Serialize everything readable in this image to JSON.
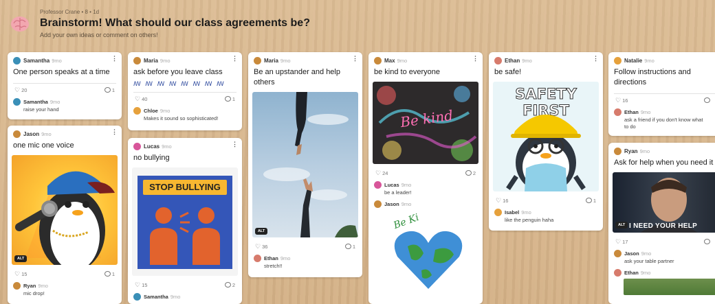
{
  "header": {
    "meta": "Professor Crane • 8 • 1d",
    "title": "Brainstorm! What should our class agreements be?",
    "subtitle": "Add your own ideas or comment on others!"
  },
  "colors": {
    "board_bg": "#d9b890",
    "card_bg": "#ffffff",
    "accent_heart": "#666666"
  },
  "cards": {
    "c1": {
      "author": "Samantha",
      "time": "9mo",
      "title": "One person speaks at a time",
      "likes": "20",
      "comments": "1",
      "comment1": {
        "author": "Samantha",
        "time": "9mo",
        "text": "raise your hand"
      }
    },
    "c2": {
      "author": "Jason",
      "time": "9mo",
      "title": "one mic one voice",
      "alt": "ALT",
      "likes": "15",
      "comments": "1",
      "comment1": {
        "author": "Ryan",
        "time": "9mo",
        "text": "mic drop!"
      }
    },
    "c3": {
      "author": "Maria",
      "time": "9mo",
      "title": "ask before you leave class",
      "squiggles": "ꟿ ꟿ ꟿ ꟿ ꟿ ꟿ ꟿ ꟿ",
      "likes": "40",
      "comments": "1",
      "comment1": {
        "author": "Chloe",
        "time": "9mo",
        "text": "Makes it sound so sophisticated!"
      }
    },
    "c4": {
      "author": "Lucas",
      "time": "9mo",
      "title": "no bullying",
      "image_text": "STOP BULLYING",
      "likes": "15",
      "comments": "2",
      "comment1": {
        "author": "Samantha",
        "time": "9mo",
        "text": ""
      }
    },
    "c5": {
      "author": "Maria",
      "time": "9mo",
      "title": "Be an upstander and help others",
      "alt": "ALT",
      "likes": "36",
      "comments": "1",
      "comment1": {
        "author": "Ethan",
        "time": "9mo",
        "text": "stretch!!"
      }
    },
    "c6": {
      "author": "Max",
      "time": "9mo",
      "title": "be kind to everyone",
      "image_text": "Be kind",
      "likes": "24",
      "comments": "2",
      "comment1": {
        "author": "Lucas",
        "time": "9mo",
        "text": "be a leader!"
      },
      "comment2": {
        "author": "Jason",
        "time": "9mo",
        "image_text": "Be Ki"
      }
    },
    "c7": {
      "author": "Ethan",
      "time": "9mo",
      "title": "be safe!",
      "image_text": "SAFETY FIRST",
      "likes": "16",
      "comments": "1",
      "comment1": {
        "author": "Isabel",
        "time": "9mo",
        "text": "like the penguin haha"
      }
    },
    "c8": {
      "author": "Natalie",
      "time": "9mo",
      "title": "Follow instructions and directions",
      "likes": "16",
      "comments": "",
      "comment1": {
        "author": "Ethan",
        "time": "9mo",
        "text": "ask a friend if you don't know what to do"
      }
    },
    "c9": {
      "author": "Ryan",
      "time": "9mo",
      "title": "Ask for help when you need it",
      "image_text": "I NEED YOUR HELP",
      "alt": "ALT",
      "likes": "17",
      "comments": "",
      "comment1": {
        "author": "Jason",
        "time": "9mo",
        "text": "ask your table partner"
      },
      "comment2": {
        "author": "Ethan",
        "time": "9mo"
      }
    }
  }
}
